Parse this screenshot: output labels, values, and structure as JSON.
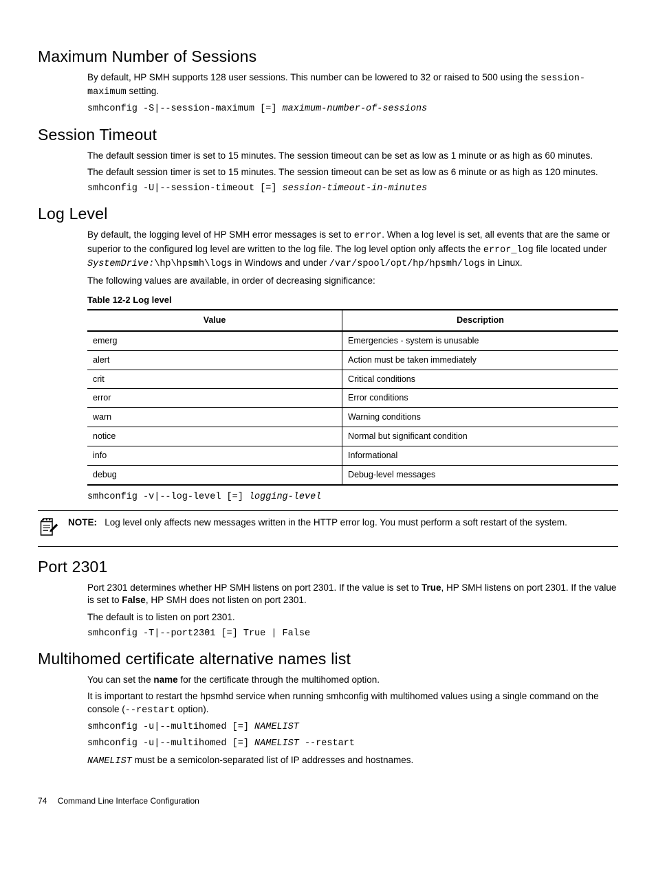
{
  "sections": {
    "maxSessions": {
      "heading": "Maximum Number of Sessions",
      "para1_a": "By default, HP SMH supports 128 user sessions. This number can be lowered to 32 or raised to 500 using the ",
      "code1": "session-maximum",
      "para1_b": " setting.",
      "cmd_prefix": "smhconfig -S|--session-maximum [=] ",
      "cmd_arg": "maximum-number-of-sessions"
    },
    "sessionTimeout": {
      "heading": "Session Timeout",
      "para1": "The default session timer is set to 15 minutes. The session timeout can be set as low as 1 minute or as high as 60 minutes.",
      "para2": "The default session timer is set to 15 minutes. The session timeout can be set as low as 6 minute or as high as 120 minutes.",
      "cmd_prefix": "smhconfig -U|--session-timeout [=] ",
      "cmd_arg": "session-timeout-in-minutes"
    },
    "logLevel": {
      "heading": "Log Level",
      "p1a": "By default, the logging level of HP SMH error messages is set to ",
      "p1_code1": "error",
      "p1b": ". When a log level is set, all events that are the same or superior to the configured log level are written to the log file. The log level option only affects the ",
      "p1_code2": "error_log",
      "p1c": " file located under  ",
      "p1_ital": "SystemDrive:",
      "p1_code3": "\\hp\\hpsmh\\logs",
      "p1d": " in Windows and under ",
      "p1_code4": "/var/spool/opt/hp/hpsmh/logs",
      "p1e": " in Linux.",
      "p2": "The following values are available, in order of decreasing significance:",
      "tableCaption": "Table 12-2 Log level",
      "thValue": "Value",
      "thDesc": "Description",
      "rows": [
        {
          "v": "emerg",
          "d": "Emergencies - system is unusable"
        },
        {
          "v": "alert",
          "d": "Action must be taken immediately"
        },
        {
          "v": "crit",
          "d": "Critical conditions"
        },
        {
          "v": "error",
          "d": "Error conditions"
        },
        {
          "v": "warn",
          "d": "Warning conditions"
        },
        {
          "v": "notice",
          "d": "Normal but significant condition"
        },
        {
          "v": "info",
          "d": "Informational"
        },
        {
          "v": "debug",
          "d": "Debug-level messages"
        }
      ],
      "cmd_prefix": "smhconfig -v|--log-level [=] ",
      "cmd_arg": "logging-level",
      "noteLabel": "NOTE:",
      "noteText": "Log level only affects new messages written in the HTTP error log. You must perform a soft restart of the system."
    },
    "port2301": {
      "heading": "Port 2301",
      "p1a": "Port 2301 determines whether HP SMH listens on port 2301. If the value is set to ",
      "p1_true": "True",
      "p1b": ", HP SMH listens on port 2301. If the value is set to ",
      "p1_false": "False",
      "p1c": ", HP SMH does not listen on port 2301.",
      "p2": "The default is to listen on port 2301.",
      "cmd": "smhconfig -T|--port2301 [=] True | False"
    },
    "multihomed": {
      "heading": "Multihomed certificate alternative names list",
      "p1a": "You can set the ",
      "p1_bold": "name",
      "p1b": " for the certificate through the multihomed option.",
      "p2a": "It is important to restart the hpsmhd service when running smhconfig with multihomed values using a single command on the console (",
      "p2_code": "--restart",
      "p2b": " option).",
      "cmd1_prefix": "smhconfig -u|--multihomed [=] ",
      "cmd1_arg": "NAMELIST",
      "cmd2_prefix": "smhconfig -u|--multihomed [=] ",
      "cmd2_arg": "NAMELIST",
      "cmd2_suffix": " --restart",
      "p3_arg": "NAMELIST",
      "p3_rest": " must be a semicolon-separated list of IP addresses and hostnames."
    }
  },
  "footer": {
    "pageNum": "74",
    "title": "Command Line Interface Configuration"
  }
}
